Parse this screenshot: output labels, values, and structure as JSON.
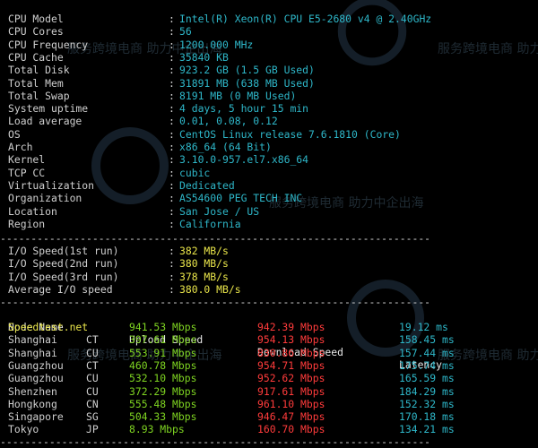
{
  "system_info": [
    {
      "label": "CPU Model",
      "value": "Intel(R) Xeon(R) CPU E5-2680 v4 @ 2.40GHz"
    },
    {
      "label": "CPU Cores",
      "value": "56"
    },
    {
      "label": "CPU Frequency",
      "value": "1200.000 MHz"
    },
    {
      "label": "CPU Cache",
      "value": "35840 KB"
    },
    {
      "label": "Total Disk",
      "value": "923.2 GB (1.5 GB Used)"
    },
    {
      "label": "Total Mem",
      "value": "31891 MB (638 MB Used)"
    },
    {
      "label": "Total Swap",
      "value": "8191 MB (0 MB Used)"
    },
    {
      "label": "System uptime",
      "value": "4 days, 5 hour 15 min"
    },
    {
      "label": "Load average",
      "value": "0.01, 0.08, 0.12"
    },
    {
      "label": "OS",
      "value": "CentOS Linux release 7.6.1810 (Core)"
    },
    {
      "label": "Arch",
      "value": "x86_64 (64 Bit)"
    },
    {
      "label": "Kernel",
      "value": "3.10.0-957.el7.x86_64"
    },
    {
      "label": "TCP CC",
      "value": "cubic"
    },
    {
      "label": "Virtualization",
      "value": "Dedicated"
    },
    {
      "label": "Organization",
      "value": "AS54600 PEG TECH INC"
    },
    {
      "label": "Location",
      "value": "San Jose / US"
    },
    {
      "label": "Region",
      "value": "California"
    }
  ],
  "separator": "----------------------------------------------------------------------",
  "io_speed": [
    {
      "label": "I/O Speed(1st run)",
      "value": "382 MB/s"
    },
    {
      "label": "I/O Speed(2nd run)",
      "value": "380 MB/s"
    },
    {
      "label": "I/O Speed(3rd run)",
      "value": "378 MB/s"
    },
    {
      "label": "Average I/O speed",
      "value": "380.0 MB/s"
    }
  ],
  "speedtest": {
    "headers": {
      "node": "Node Name",
      "upload": "Upload Speed",
      "download": "Download Speed",
      "latency": "Latency"
    },
    "rows": [
      {
        "node": "Speedtest.net",
        "isp": "",
        "upload": "941.53 Mbps",
        "download": "942.39 Mbps",
        "latency": "19.12 ms"
      },
      {
        "node": "Shanghai",
        "isp": "CT",
        "upload": "397.61 Mbps",
        "download": "954.13 Mbps",
        "latency": "158.45 ms"
      },
      {
        "node": "Shanghai",
        "isp": "CU",
        "upload": "553.91 Mbps",
        "download": "830.86 Mbps",
        "latency": "157.44 ms"
      },
      {
        "node": "Guangzhou",
        "isp": "CT",
        "upload": "460.78 Mbps",
        "download": "954.71 Mbps",
        "latency": "175.74 ms"
      },
      {
        "node": "Guangzhou",
        "isp": "CU",
        "upload": "532.10 Mbps",
        "download": "952.62 Mbps",
        "latency": "165.59 ms"
      },
      {
        "node": "Shenzhen",
        "isp": "CU",
        "upload": "372.29 Mbps",
        "download": "917.61 Mbps",
        "latency": "184.29 ms"
      },
      {
        "node": "Hongkong",
        "isp": "CN",
        "upload": "555.48 Mbps",
        "download": "961.10 Mbps",
        "latency": "152.32 ms"
      },
      {
        "node": "Singapore",
        "isp": "SG",
        "upload": "504.33 Mbps",
        "download": "946.47 Mbps",
        "latency": "170.18 ms"
      },
      {
        "node": "Tokyo",
        "isp": "JP",
        "upload": "8.93 Mbps",
        "download": "160.70 Mbps",
        "latency": "134.21 ms"
      }
    ]
  },
  "watermark": {
    "text": "服务跨境电商 助力中企出海"
  },
  "colors": {
    "label": "#cfcfcf",
    "value": "#2eb7c9",
    "upload": "#7ed321",
    "download": "#ff3b3b",
    "highlight": "#e9e54a"
  }
}
